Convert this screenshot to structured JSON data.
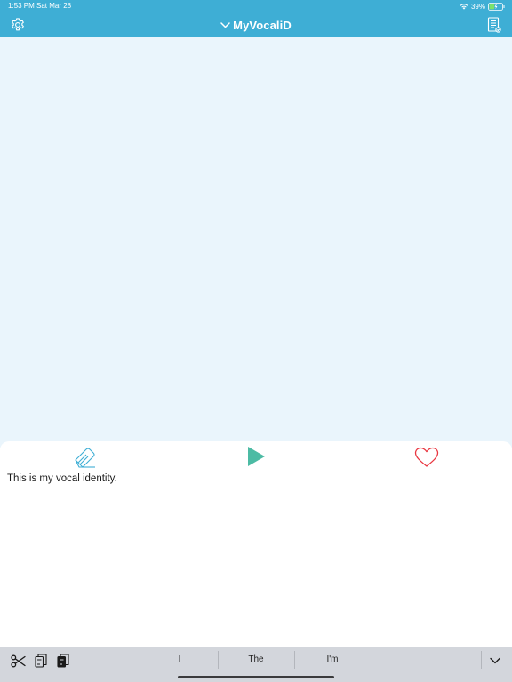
{
  "status_bar": {
    "time": "1:53 PM",
    "date": "Sat Mar 28",
    "battery": "39%"
  },
  "nav": {
    "title": "MyVocaliD"
  },
  "composer": {
    "text": "This is my vocal identity."
  },
  "suggestions": [
    "I",
    "The",
    "I'm"
  ],
  "colors": {
    "accent": "#3eaed5",
    "main_background": "#eaf5fc",
    "play": "#4cbba4",
    "heart": "#e9353f",
    "keyboard_bar": "#d3d6dc"
  },
  "icons": {
    "settings": "gear-icon",
    "nav_chevron": "chevron-down-icon",
    "document": "document-icon",
    "eraser": "eraser-icon",
    "play": "play-icon",
    "favorite": "heart-icon",
    "cut": "scissors-icon",
    "copy": "copy-icon",
    "paste": "paste-icon",
    "dismiss_keyboard": "chevron-down-icon"
  }
}
